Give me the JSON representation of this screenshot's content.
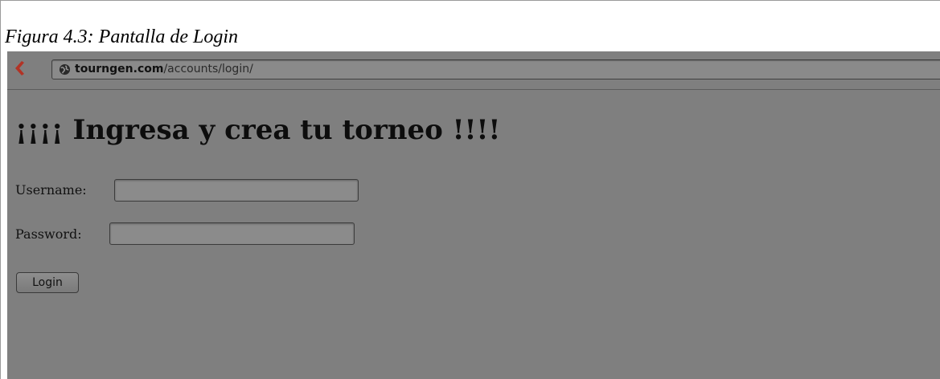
{
  "figure": {
    "caption": "Figura 4.3: Pantalla de Login"
  },
  "browser": {
    "back_icon": "chevron-left-icon",
    "site_icon": "globe-icon",
    "url_domain": "tourngen.com",
    "url_path": "/accounts/login/"
  },
  "page": {
    "heading": "¡¡¡¡ Ingresa y crea tu torneo !!!!",
    "username_label": "Username:",
    "username_value": "",
    "password_label": "Password:",
    "password_value": "",
    "login_button": "Login"
  },
  "colors": {
    "page_background": "#7f7f7f",
    "back_arrow": "#c0392b",
    "text": "#0d0d0d"
  }
}
